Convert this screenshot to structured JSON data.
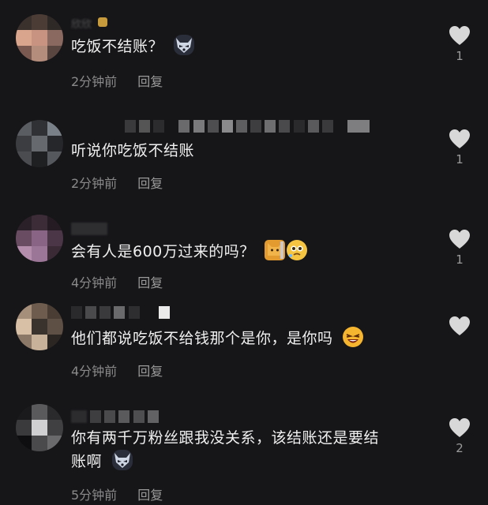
{
  "comments": [
    {
      "username": "欣欣",
      "text": "吃饭不结账？",
      "time": "2分钟前",
      "reply": "回复",
      "likes": "1"
    },
    {
      "username": "",
      "text": "听说你吃饭不结账",
      "time": "2分钟前",
      "reply": "回复",
      "likes": "1"
    },
    {
      "username": "",
      "text": "会有人是600万过来的吗？",
      "time": "4分钟前",
      "reply": "回复",
      "likes": "1"
    },
    {
      "username": "",
      "text": "他们都说吃饭不给钱那个是你，是你吗",
      "time": "4分钟前",
      "reply": "回复",
      "likes": ""
    },
    {
      "username": "",
      "text_line1": "你有两千万粉丝跟我没关系，该结账还是要结",
      "text_line2": "账啊",
      "time": "5分钟前",
      "reply": "回复",
      "likes": "2"
    }
  ],
  "colors": {
    "background": "#161518",
    "text": "#f0f0f0",
    "meta": "#8a8a8a",
    "heart": "#d8d8d8"
  }
}
